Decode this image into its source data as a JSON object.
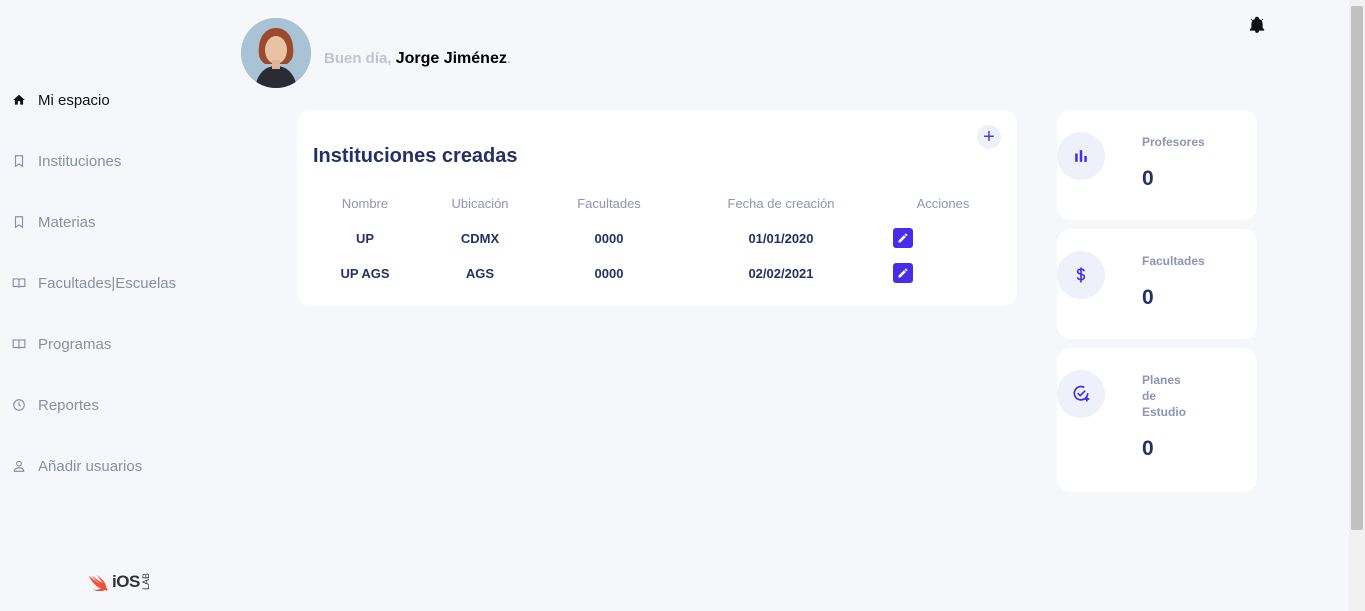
{
  "greeting": {
    "hello": "Buen día,",
    "name": "Jorge Jiménez",
    "trail": "."
  },
  "sidebar": {
    "items": [
      {
        "label": "Mi espacio",
        "icon": "home-icon",
        "active": true
      },
      {
        "label": "Instituciones",
        "icon": "bookmark-icon"
      },
      {
        "label": "Materias",
        "icon": "bookmark-icon"
      },
      {
        "label": "Facultades|Escuelas",
        "icon": "book-icon"
      },
      {
        "label": "Programas",
        "icon": "book-icon"
      },
      {
        "label": "Reportes",
        "icon": "clock-icon"
      },
      {
        "label": "Añadir usuarios",
        "icon": "user-icon"
      }
    ],
    "logo": {
      "text": "iOS",
      "sub": "LAB"
    }
  },
  "table_card": {
    "title": "Instituciones creadas",
    "add_label": "+",
    "columns": [
      "Nombre",
      "Ubicación",
      "Facultades",
      "Fecha de creación",
      "Acciones"
    ],
    "rows": [
      {
        "nombre": "UP",
        "ubicacion": "CDMX",
        "facultades": "0000",
        "fecha": "01/01/2020"
      },
      {
        "nombre": "UP AGS",
        "ubicacion": "AGS",
        "facultades": "0000",
        "fecha": "02/02/2021"
      }
    ]
  },
  "stats": [
    {
      "label": "Profesores",
      "value": "0",
      "icon": "bar-chart-icon"
    },
    {
      "label": "Facultades",
      "value": "0",
      "icon": "dollar-icon"
    },
    {
      "label_lines": [
        "Planes",
        "de",
        "Estudio"
      ],
      "value": "0",
      "icon": "check-add-icon"
    }
  ],
  "colors": {
    "accent": "#4a2be8",
    "title": "#25306a",
    "background": "#f6f7fb"
  }
}
